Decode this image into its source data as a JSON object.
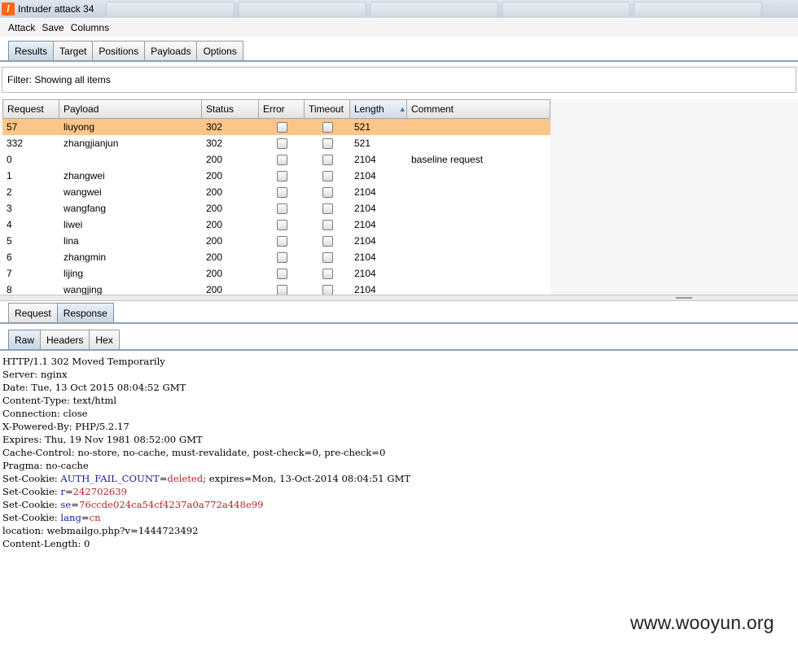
{
  "window": {
    "title": "Intruder attack 34",
    "icon_letter": "/"
  },
  "menu": [
    "Attack",
    "Save",
    "Columns"
  ],
  "main_tabs": [
    {
      "label": "Results",
      "active": true
    },
    {
      "label": "Target",
      "active": false
    },
    {
      "label": "Positions",
      "active": false
    },
    {
      "label": "Payloads",
      "active": false
    },
    {
      "label": "Options",
      "active": false
    }
  ],
  "filter": {
    "text": "Filter: Showing all items"
  },
  "table": {
    "columns": [
      "Request",
      "Payload",
      "Status",
      "Error",
      "Timeout",
      "Length",
      "Comment"
    ],
    "sorted_column": "Length",
    "rows": [
      {
        "request": "57",
        "payload": "liuyong",
        "status": "302",
        "length": "521",
        "comment": "",
        "selected": true
      },
      {
        "request": "332",
        "payload": "zhangjianjun",
        "status": "302",
        "length": "521",
        "comment": ""
      },
      {
        "request": "0",
        "payload": "",
        "status": "200",
        "length": "2104",
        "comment": "baseline request"
      },
      {
        "request": "1",
        "payload": "zhangwei",
        "status": "200",
        "length": "2104",
        "comment": ""
      },
      {
        "request": "2",
        "payload": "wangwei",
        "status": "200",
        "length": "2104",
        "comment": ""
      },
      {
        "request": "3",
        "payload": "wangfang",
        "status": "200",
        "length": "2104",
        "comment": ""
      },
      {
        "request": "4",
        "payload": "liwei",
        "status": "200",
        "length": "2104",
        "comment": ""
      },
      {
        "request": "5",
        "payload": "lina",
        "status": "200",
        "length": "2104",
        "comment": ""
      },
      {
        "request": "6",
        "payload": "zhangmin",
        "status": "200",
        "length": "2104",
        "comment": ""
      },
      {
        "request": "7",
        "payload": "lijing",
        "status": "200",
        "length": "2104",
        "comment": ""
      },
      {
        "request": "8",
        "payload": "wangjing",
        "status": "200",
        "length": "2104",
        "comment": ""
      }
    ]
  },
  "req_resp_tabs": [
    {
      "label": "Request",
      "active": false
    },
    {
      "label": "Response",
      "active": true
    }
  ],
  "view_tabs": [
    {
      "label": "Raw",
      "active": true
    },
    {
      "label": "Headers",
      "active": false
    },
    {
      "label": "Hex",
      "active": false
    }
  ],
  "response": {
    "lines": [
      "HTTP/1.1 302 Moved Temporarily",
      "Server: nginx",
      "Date: Tue, 13 Oct 2015 08:04:52 GMT",
      "Content-Type: text/html",
      "Connection: close",
      "X-Powered-By: PHP/5.2.17",
      "Expires: Thu, 19 Nov 1981 08:52:00 GMT",
      "Cache-Control: no-store, no-cache, must-revalidate, post-check=0, pre-check=0",
      "Pragma: no-cache"
    ],
    "cookies": [
      {
        "prefix": "Set-Cookie: ",
        "name": "AUTH_FAIL_COUNT",
        "eq": "=",
        "value": "deleted",
        "rest": "; expires=Mon, 13-Oct-2014 08:04:51 GMT"
      },
      {
        "prefix": "Set-Cookie: ",
        "name": "r",
        "eq": "=",
        "value": "242702639",
        "rest": ""
      },
      {
        "prefix": "Set-Cookie: ",
        "name": "se",
        "eq": "=",
        "value": "76ccde024ca54cf4237a0a772a448e99",
        "rest": ""
      },
      {
        "prefix": "Set-Cookie: ",
        "name": "lang",
        "eq": "=",
        "value": "cn",
        "rest": ""
      }
    ],
    "tail_lines": [
      "location: webmailgo.php?v=1444723492",
      "Content-Length: 0"
    ]
  },
  "watermark": "www.wooyun.org",
  "colors": {
    "selected_row": "#fbc68a",
    "cookie_name": "#1a1aa6",
    "cookie_value": "#b0252a",
    "app_icon": "#ff6a13"
  }
}
